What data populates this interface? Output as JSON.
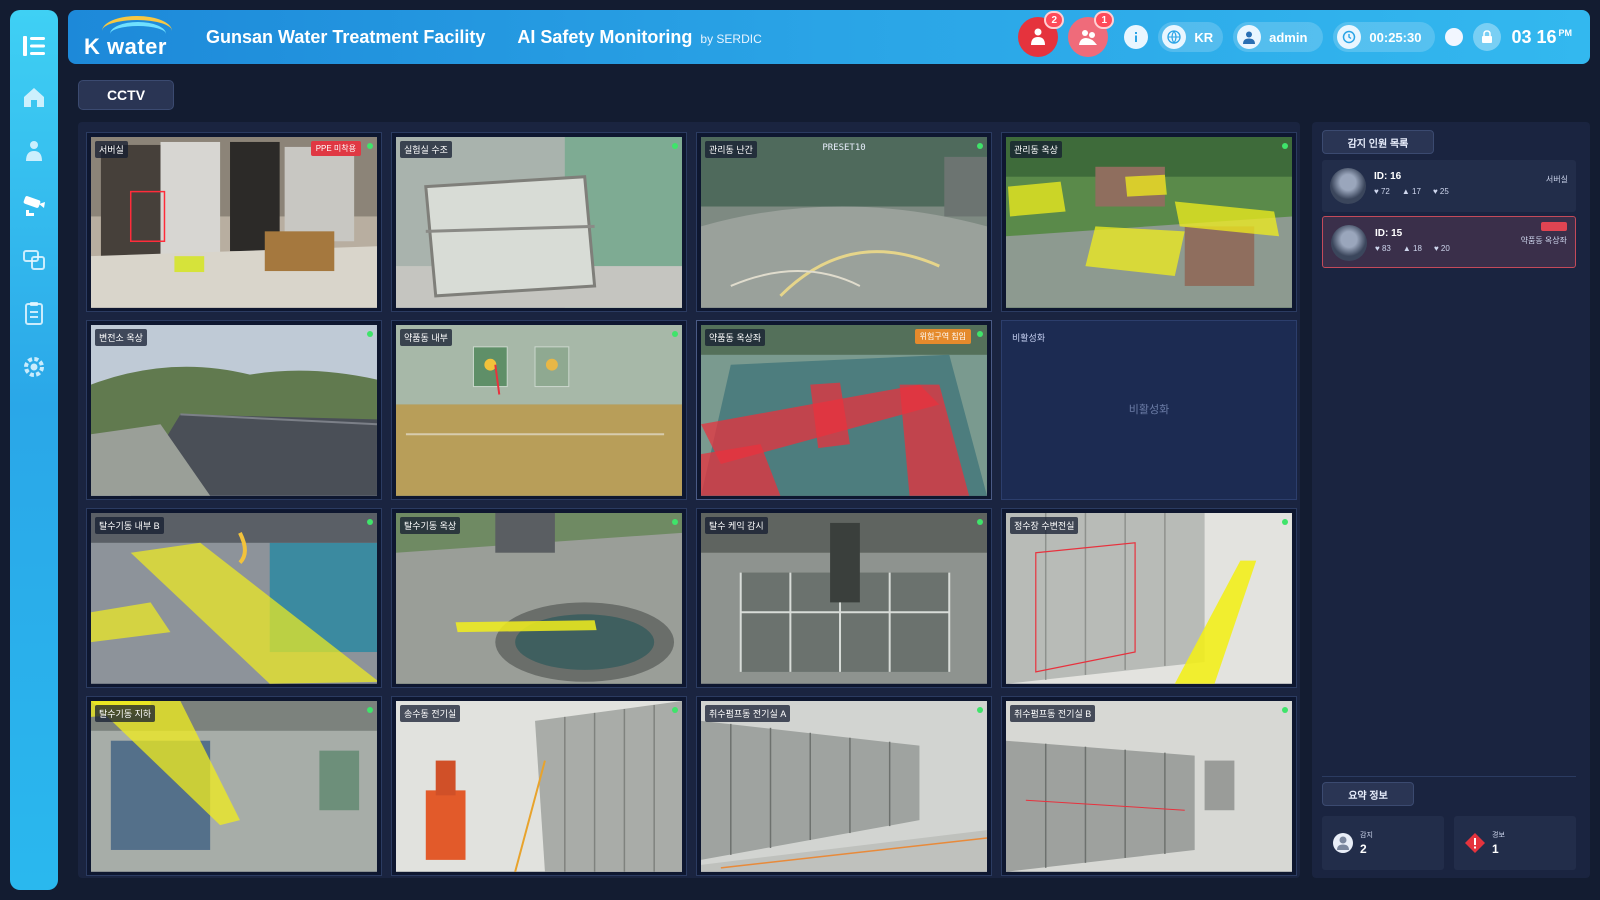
{
  "header": {
    "logo_text": "K water",
    "facility": "Gunsan Water Treatment Facility",
    "system": "AI Safety Monitoring",
    "by": "by SERDIC",
    "alert_badge_1": "2",
    "alert_badge_2": "1",
    "language": "KR",
    "user": "admin",
    "session_timer": "00:25:30",
    "clock": "03 16",
    "clock_suffix": "PM"
  },
  "tab": {
    "label": "CCTV"
  },
  "cameras": [
    {
      "name": "서버실",
      "warn": "PPE 미착용"
    },
    {
      "name": "실험실 수조"
    },
    {
      "name": "관리동 난간",
      "ptz": "PRESET10"
    },
    {
      "name": "관리동 옥상"
    },
    {
      "name": "변전소 옥상"
    },
    {
      "name": "약품동 내부"
    },
    {
      "name": "약품동 옥상좌",
      "warn": "위험구역 침입"
    },
    {
      "name": "비활성화",
      "disabled_text": "비활성화"
    },
    {
      "name": "탈수기동 내부 B"
    },
    {
      "name": "탈수기동 옥상"
    },
    {
      "name": "탈수 케익 감시"
    },
    {
      "name": "정수장 수변전실"
    },
    {
      "name": "탈수기동 지하"
    },
    {
      "name": "송수동 전기실"
    },
    {
      "name": "취수펌프동 전기실 A"
    },
    {
      "name": "취수펌프동 전기실 B"
    }
  ],
  "panel": {
    "title": "감지 인원 목록",
    "detections": [
      {
        "id": "ID: 16",
        "s1": "72",
        "s2": "17",
        "s3": "25",
        "location": "서버실"
      },
      {
        "id": "ID: 15",
        "s1": "83",
        "s2": "18",
        "s3": "20",
        "location": "약품동 옥상좌"
      }
    ],
    "summary_title": "요약 정보",
    "summary": [
      {
        "label": "감지",
        "value": "2"
      },
      {
        "label": "경보",
        "value": "1"
      }
    ]
  },
  "colors": {
    "accent": "#2aa4e6",
    "alert": "#e5333d",
    "zone_yellow": "#f2ee1c",
    "zone_red": "#e8313d",
    "live": "#3fe46a"
  }
}
